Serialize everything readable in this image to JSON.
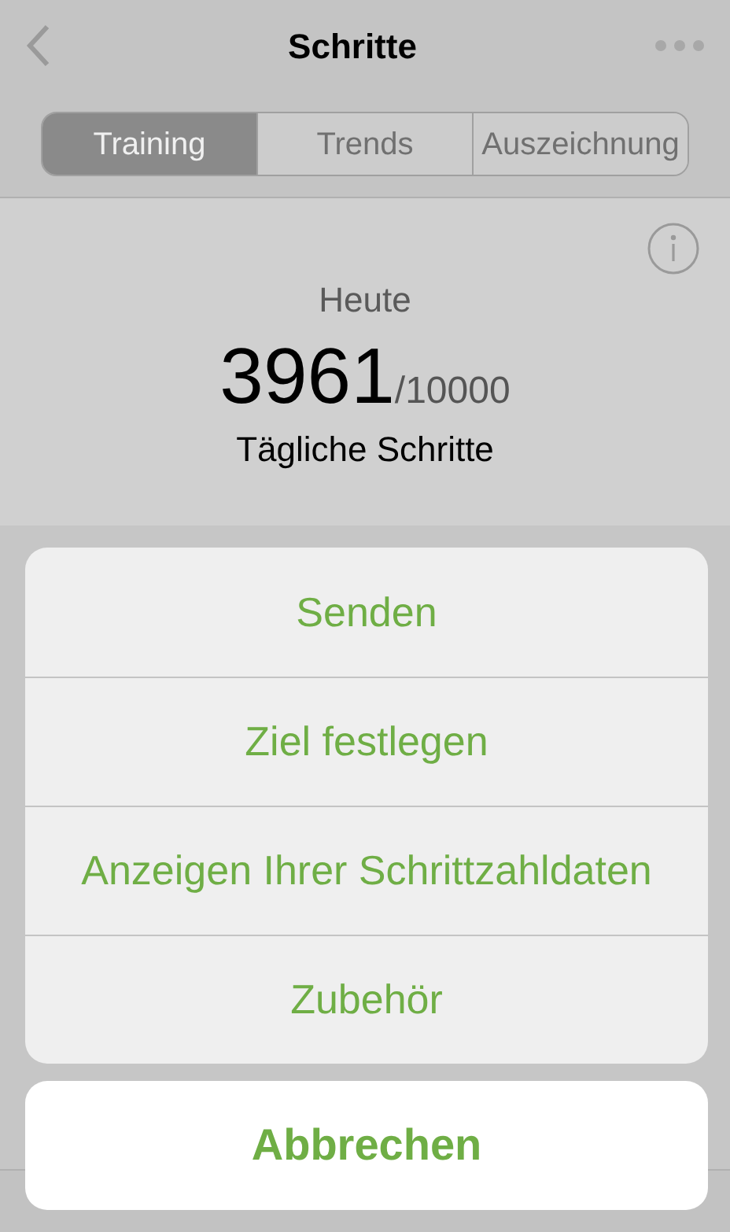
{
  "nav": {
    "title": "Schritte"
  },
  "tabs": [
    {
      "label": "Training",
      "selected": true
    },
    {
      "label": "Trends",
      "selected": false
    },
    {
      "label": "Auszeichnung",
      "selected": false
    }
  ],
  "summary": {
    "heading": "Heute",
    "steps": "3961",
    "goal": "/10000",
    "caption": "Tägliche Schritte"
  },
  "action_sheet": {
    "actions": [
      "Senden",
      "Ziel festlegen",
      "Anzeigen Ihrer Schrittzahldaten",
      "Zubehör"
    ],
    "cancel": "Abbrechen"
  }
}
